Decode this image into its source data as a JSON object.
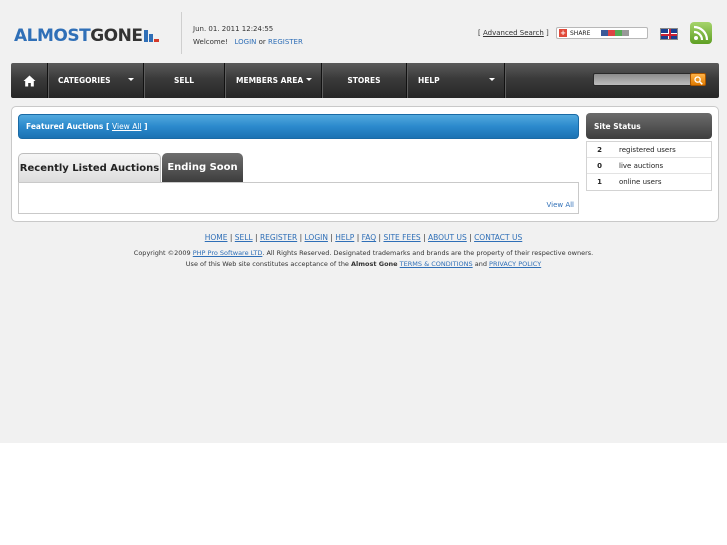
{
  "header": {
    "logo": {
      "part1": "ALMOST",
      "part2": "GONE"
    },
    "datetime": "Jun. 01. 2011 12:24:55",
    "welcome": "Welcome!",
    "login_label": "LOGIN",
    "or_text": "or",
    "register_label": "REGISTER",
    "advanced_search": "Advanced Search",
    "share_label": "SHARE",
    "language_flag": "uk-flag-icon",
    "rss_icon": "rss-icon"
  },
  "nav": {
    "home_icon": "home-icon",
    "items": [
      {
        "label": "CATEGORIES",
        "dropdown": true
      },
      {
        "label": "SELL",
        "dropdown": false
      },
      {
        "label": "MEMBERS AREA",
        "dropdown": true
      },
      {
        "label": "STORES",
        "dropdown": false
      },
      {
        "label": "HELP",
        "dropdown": true
      }
    ],
    "search": {
      "value": "",
      "button_icon": "search-icon"
    }
  },
  "featured": {
    "title": "Featured Auctions",
    "view_all": "View All"
  },
  "tabs": [
    {
      "label": "Recently Listed Auctions",
      "active": true
    },
    {
      "label": "Ending Soon",
      "active": false
    }
  ],
  "panel": {
    "view_all": "View All"
  },
  "site_status": {
    "title": "Site Status",
    "rows": [
      {
        "value": "2",
        "label": "registered users"
      },
      {
        "value": "0",
        "label": "live auctions"
      },
      {
        "value": "1",
        "label": "online users"
      }
    ]
  },
  "footer": {
    "links": [
      "HOME",
      "SELL",
      "REGISTER",
      "LOGIN",
      "HELP",
      "FAQ",
      "SITE FEES",
      "ABOUT US",
      "CONTACT US"
    ],
    "copyright_prefix": "Copyright ©2009",
    "company": "PHP Pro Software LTD",
    "copyright_suffix": ". All Rights Reserved. Designated trademarks and brands are the property of their respective owners.",
    "terms_prefix": "Use of this Web site constitutes acceptance of the",
    "site_name": "Almost Gone",
    "terms_label": "TERMS & CONDITIONS",
    "and_text": "and",
    "privacy_label": "PRIVACY POLICY"
  },
  "colors": {
    "brand_blue": "#2f6fb7",
    "nav_dark": "#2b2b2b",
    "featured_blue": "#2b89cc",
    "search_orange": "#f08c00"
  }
}
